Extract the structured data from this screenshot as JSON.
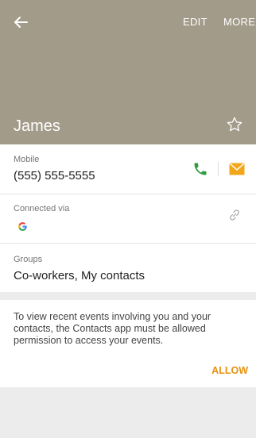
{
  "toolbar": {
    "edit_label": "EDIT",
    "more_label": "MORE",
    "back_icon": "arrow-left-icon"
  },
  "contact": {
    "name": "James",
    "favorite_icon": "star-outline-icon"
  },
  "mobile": {
    "label": "Mobile",
    "value": "(555) 555-5555",
    "call_icon": "phone-icon",
    "message_icon": "envelope-icon",
    "call_color": "#2e9c3f",
    "message_color": "#f2a71b"
  },
  "connected": {
    "label": "Connected via",
    "account_icon": "google-g-icon",
    "link_icon": "link-icon"
  },
  "groups": {
    "label": "Groups",
    "value": "Co-workers, My contacts"
  },
  "permission": {
    "message": "To view recent events involving you and your contacts, the Contacts app must be allowed permission to access your events.",
    "allow_label": "ALLOW",
    "allow_color": "#e8910e"
  },
  "colors": {
    "header_bg": "#a39b8a",
    "page_bg": "#ececec"
  }
}
